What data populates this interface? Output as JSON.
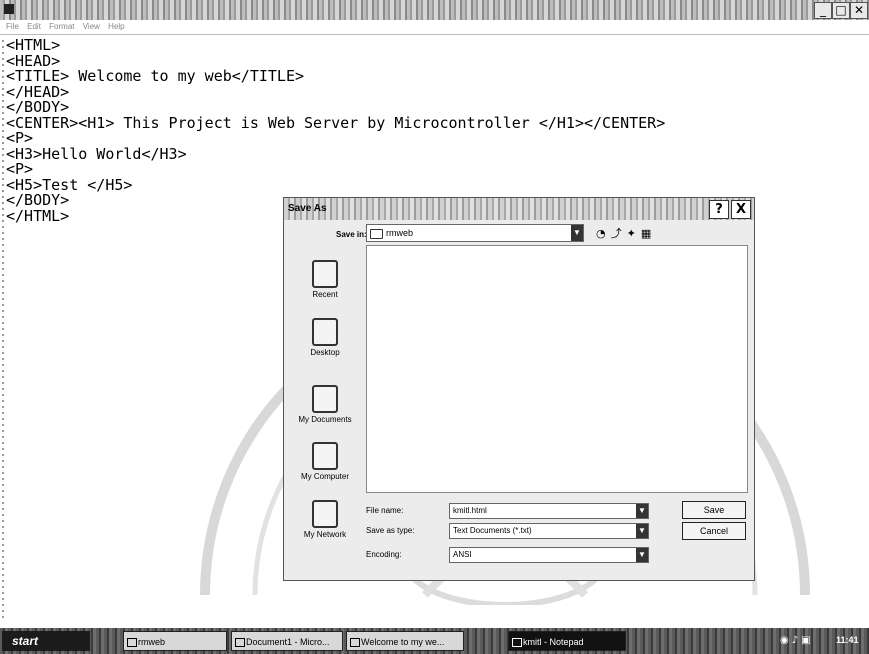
{
  "menu": [
    "File",
    "Edit",
    "Format",
    "View",
    "Help"
  ],
  "editor": {
    "text": "<HTML>\n<HEAD>\n<TITLE> Welcome to my web</TITLE>\n</HEAD>\n</BODY>\n<CENTER><H1> This Project is Web Server by Microcontroller </H1></CENTER>\n<P>\n<H3>Hello World</H3>\n<P>\n<H5>Test </H5>\n</BODY>\n</HTML>"
  },
  "dialog": {
    "title": "Save As",
    "help": "?",
    "close": "X",
    "save_in_label": "Save in:",
    "save_in_value": "rmweb",
    "places": [
      "Recent",
      "Desktop",
      "My Documents",
      "My Computer",
      "My Network"
    ],
    "file_name_label": "File name:",
    "file_name_value": "kmitl.html",
    "save_type_label": "Save as type:",
    "save_type_value": "Text Documents (*.txt)",
    "encoding_label": "Encoding:",
    "encoding_value": "ANSI",
    "save_button": "Save",
    "cancel_button": "Cancel"
  },
  "taskbar": {
    "start": "start",
    "tasks": [
      "rmweb",
      "Document1 - Micro...",
      "Welcome to my we...",
      "kmitl - Notepad"
    ],
    "clock": "11:41"
  }
}
